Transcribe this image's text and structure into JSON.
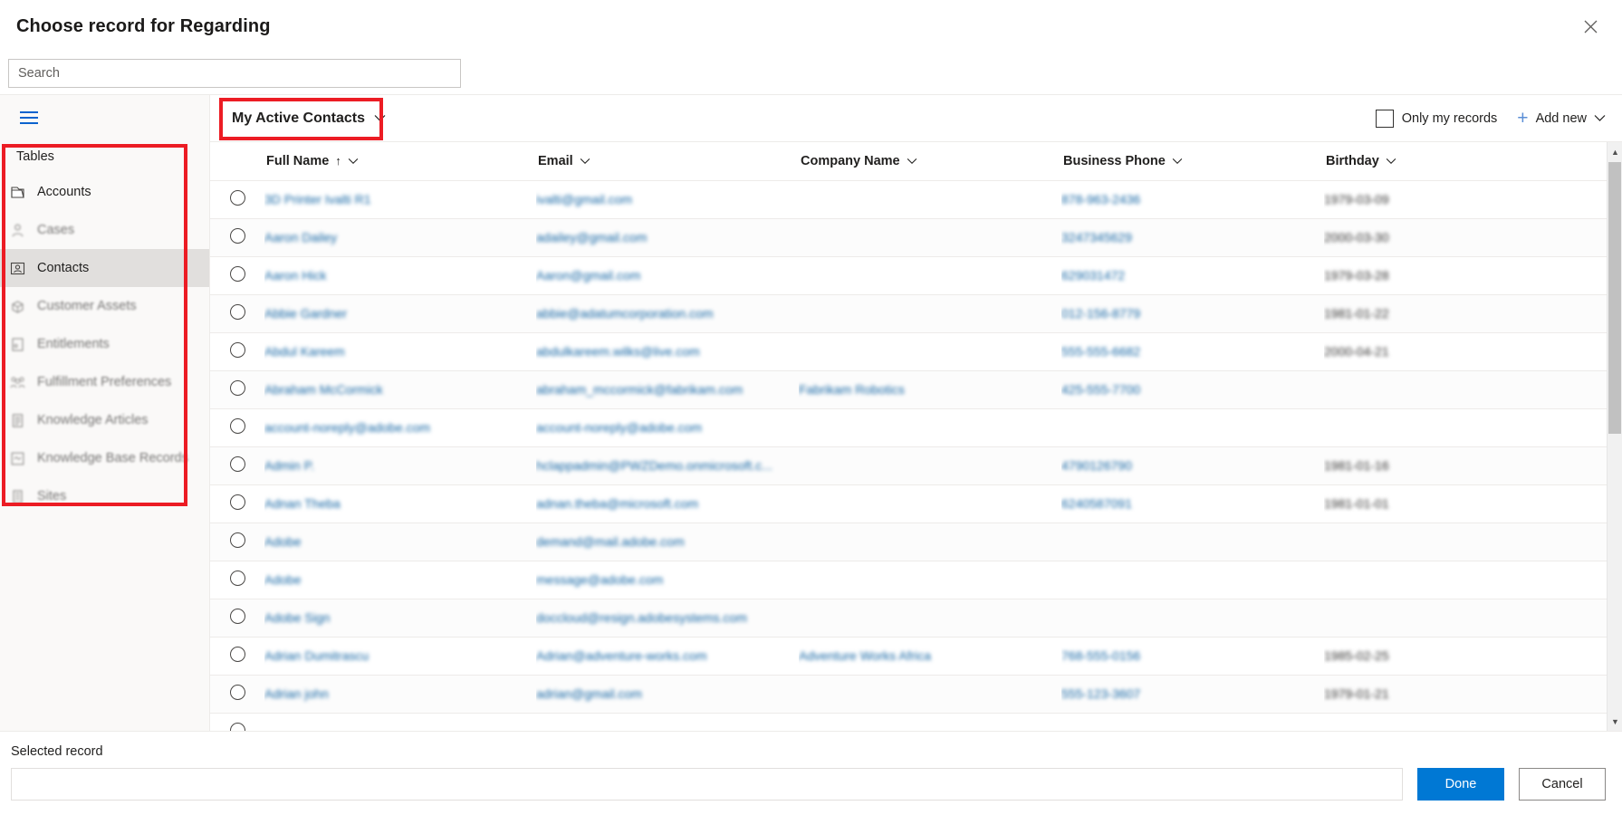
{
  "dialog": {
    "title": "Choose record for Regarding",
    "close_label": "×"
  },
  "search": {
    "placeholder": "Search",
    "value": ""
  },
  "sidebar": {
    "hamburger_label": "Expand navigation",
    "group_label": "Tables",
    "items": [
      {
        "label": "Accounts",
        "icon": "account-icon",
        "state": "normal"
      },
      {
        "label": "Cases",
        "icon": "case-person-icon",
        "state": "dim"
      },
      {
        "label": "Contacts",
        "icon": "contact-card-icon",
        "state": "selected"
      },
      {
        "label": "Customer Assets",
        "icon": "asset-box-icon",
        "state": "dim"
      },
      {
        "label": "Entitlements",
        "icon": "entitlement-doc-icon",
        "state": "dim"
      },
      {
        "label": "Fulfillment Preferences",
        "icon": "people-group-icon",
        "state": "dim"
      },
      {
        "label": "Knowledge Articles",
        "icon": "article-page-icon",
        "state": "dim"
      },
      {
        "label": "Knowledge Base Records",
        "icon": "kb-record-icon",
        "state": "dim"
      },
      {
        "label": "Sites",
        "icon": "site-list-icon",
        "state": "dim"
      }
    ]
  },
  "commandbar": {
    "view_name": "My Active Contacts",
    "view_chevron": "chevron-down-icon",
    "only_my_records_label": "Only my records",
    "only_my_records_checked": false,
    "add_new_label": "Add new",
    "add_new_plus": "+",
    "add_new_chevron": "chevron-down-icon"
  },
  "grid": {
    "columns": [
      {
        "label": "Full Name",
        "sorted": true,
        "sort_dir": "ascending",
        "sort_glyph": "↑"
      },
      {
        "label": "Email",
        "sorted": false
      },
      {
        "label": "Company Name",
        "sorted": false
      },
      {
        "label": "Business Phone",
        "sorted": false
      },
      {
        "label": "Birthday",
        "sorted": false
      }
    ],
    "rows": [
      {
        "full_name": "3D Printer Ivalti R1",
        "email": "ivalti@gmail.com",
        "company": "",
        "phone": "878-963-2436",
        "birthday": "1979-03-09"
      },
      {
        "full_name": "Aaron Dailey",
        "email": "adailey@gmail.com",
        "company": "",
        "phone": "3247345629",
        "birthday": "2000-03-30"
      },
      {
        "full_name": "Aaron Hick",
        "email": "Aaron@gmail.com",
        "company": "",
        "phone": "629031472",
        "birthday": "1979-03-28"
      },
      {
        "full_name": "Abbie Gardner",
        "email": "abbie@adatumcorporation.com",
        "company": "",
        "phone": "012-156-8779",
        "birthday": "1981-01-22"
      },
      {
        "full_name": "Abdul Kareem",
        "email": "abdulkareem.wilks@live.com",
        "company": "",
        "phone": "555-555-6682",
        "birthday": "2000-04-21"
      },
      {
        "full_name": "Abraham McCormick",
        "email": "abraham_mccormick@fabrikam.com",
        "company": "Fabrikam Robotics",
        "phone": "425-555-7700",
        "birthday": ""
      },
      {
        "full_name": "account-noreply@adobe.com",
        "email": "account-noreply@adobe.com",
        "company": "",
        "phone": "",
        "birthday": ""
      },
      {
        "full_name": "Admin P.",
        "email": "hclappadmin@PWZDemo.onmicrosoft.c...",
        "company": "",
        "phone": "4790126790",
        "birthday": "1981-01-16"
      },
      {
        "full_name": "Adnan Theba",
        "email": "adnan.theba@microsoft.com",
        "company": "",
        "phone": "6240587091",
        "birthday": "1981-01-01"
      },
      {
        "full_name": "Adobe",
        "email": "demand@mail.adobe.com",
        "company": "",
        "phone": "",
        "birthday": ""
      },
      {
        "full_name": "Adobe",
        "email": "message@adobe.com",
        "company": "",
        "phone": "",
        "birthday": ""
      },
      {
        "full_name": "Adobe Sign",
        "email": "doccloud@resign.adobesystems.com",
        "company": "",
        "phone": "",
        "birthday": ""
      },
      {
        "full_name": "Adrian Dumitrascu",
        "email": "Adrian@adventure-works.com",
        "company": "Adventure Works Africa",
        "phone": "768-555-0156",
        "birthday": "1985-02-25"
      },
      {
        "full_name": "Adrian john",
        "email": "adrian@gmail.com",
        "company": "",
        "phone": "555-123-3607",
        "birthday": "1979-01-21"
      },
      {
        "full_name": "",
        "email": "",
        "company": "",
        "phone": "",
        "birthday": ""
      }
    ]
  },
  "footer": {
    "selected_record_label": "Selected record",
    "selected_record_value": "",
    "done_label": "Done",
    "cancel_label": "Cancel"
  },
  "colors": {
    "accent": "#0078d4",
    "link": "#1264a3",
    "highlight_outline": "#ec1c24",
    "nav_selected_bg": "#e1dfdd"
  }
}
